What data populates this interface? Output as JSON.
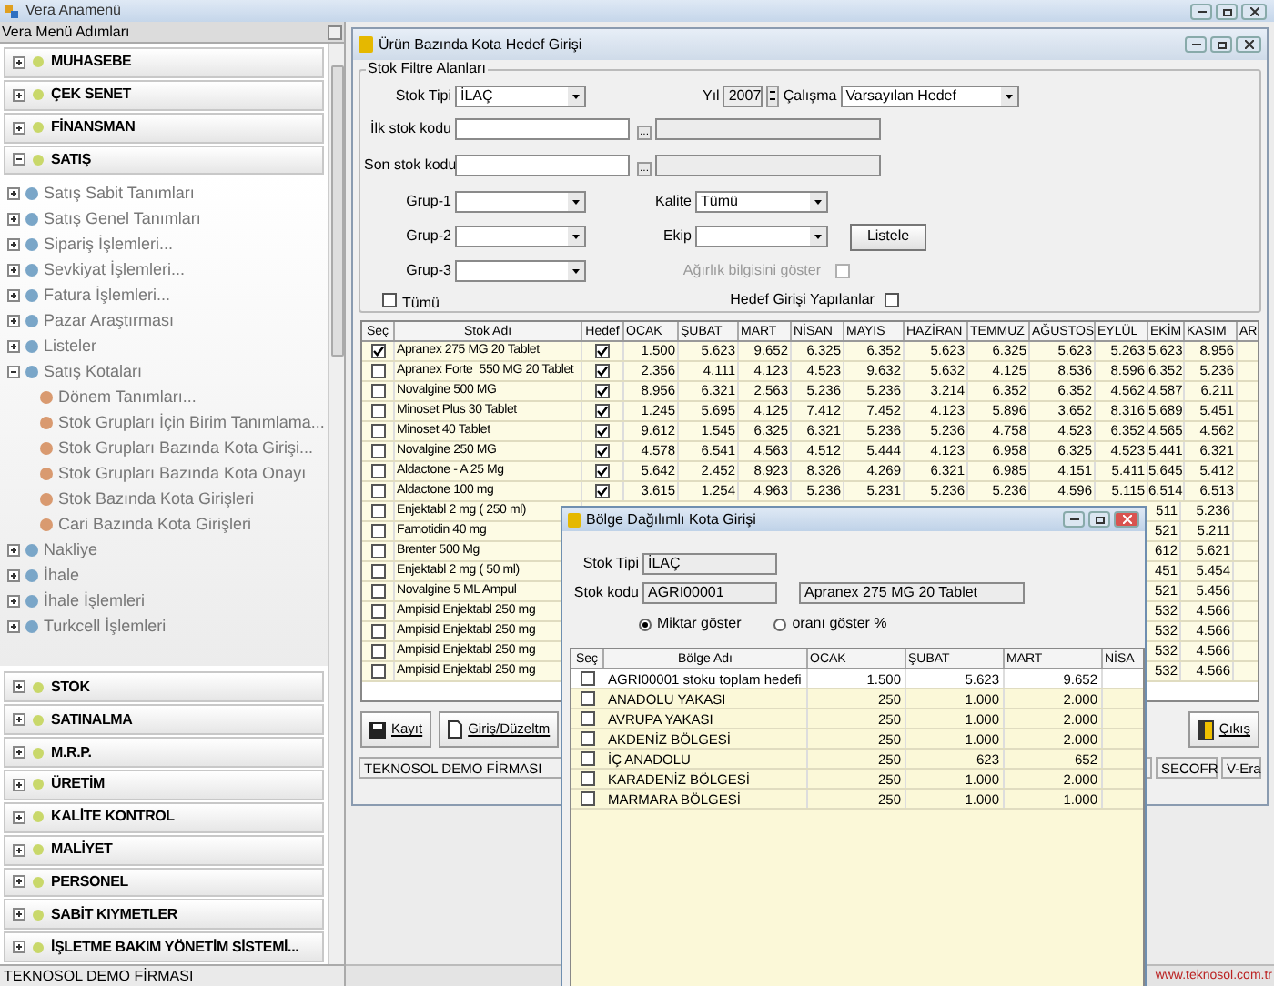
{
  "app_title": "Vera Anamenü",
  "menu": {
    "title": "Vera Menü Adımları",
    "sections_top": [
      {
        "label": "MUHASEBE",
        "expanded": false
      },
      {
        "label": "ÇEK SENET",
        "expanded": false
      },
      {
        "label": "FİNANSMAN",
        "expanded": false
      },
      {
        "label": "SATIŞ",
        "expanded": true
      }
    ],
    "tree": [
      {
        "label": "Satış Sabit Tanımları",
        "expanded": false
      },
      {
        "label": "Satış Genel Tanımları",
        "expanded": false
      },
      {
        "label": "Sipariş İşlemleri...",
        "expanded": false
      },
      {
        "label": "Sevkiyat İşlemleri...",
        "expanded": false
      },
      {
        "label": "Fatura İşlemleri...",
        "expanded": false
      },
      {
        "label": "Pazar Araştırması",
        "expanded": false
      },
      {
        "label": "Listeler",
        "expanded": false
      },
      {
        "label": "Satış Kotaları",
        "expanded": true,
        "children": [
          {
            "label": "Dönem Tanımları..."
          },
          {
            "label": "Stok Grupları İçin Birim Tanımlama..."
          },
          {
            "label": "Stok Grupları Bazında Kota Girişi..."
          },
          {
            "label": "Stok Grupları Bazında Kota Onayı"
          },
          {
            "label": "Stok Bazında Kota Girişleri"
          },
          {
            "label": "Cari Bazında Kota Girişleri"
          }
        ]
      },
      {
        "label": "Nakliye",
        "expanded": false
      },
      {
        "label": "İhale",
        "expanded": false
      },
      {
        "label": "İhale İşlemleri",
        "expanded": false
      },
      {
        "label": "Turkcell İşlemleri",
        "expanded": false
      }
    ],
    "sections_bottom": [
      {
        "label": "STOK",
        "expanded": false
      },
      {
        "label": "SATINALMA",
        "expanded": false
      },
      {
        "label": "M.R.P.",
        "expanded": false
      },
      {
        "label": "ÜRETİM",
        "expanded": false
      },
      {
        "label": "KALİTE KONTROL",
        "expanded": false
      },
      {
        "label": "MALİYET",
        "expanded": false
      },
      {
        "label": "PERSONEL",
        "expanded": false
      },
      {
        "label": "SABİT KIYMETLER",
        "expanded": false
      },
      {
        "label": "İŞLETME BAKIM YÖNETİM SİSTEMİ...",
        "expanded": false
      }
    ]
  },
  "status_left": "TEKNOSOL DEMO FİRMASI",
  "status_right": "www.teknosol.com.tr",
  "form": {
    "title": "Ürün Bazında Kota Hedef Girişi",
    "filter_title": "Stok Filtre Alanları",
    "stok_tipi": {
      "label": "Stok Tipi",
      "value": "İLAÇ"
    },
    "yil": {
      "label": "Yıl",
      "value": "2007"
    },
    "calisma": {
      "label": "Çalışma",
      "value": "Varsayılan Hedef"
    },
    "ilk_stok_kodu": {
      "label": "İlk stok kodu",
      "button": "..."
    },
    "son_stok_kodu": {
      "label": "Son stok kodu",
      "button": "..."
    },
    "grup_1": {
      "label": "Grup-1"
    },
    "grup_2": {
      "label": "Grup-2"
    },
    "grup_3": {
      "label": "Grup-3"
    },
    "kalite": {
      "label": "Kalite",
      "value": "Tümü"
    },
    "ekip": {
      "label": "Ekip"
    },
    "listele": "Listele",
    "agirlik": {
      "label": "Ağırlık bilgisini göster",
      "checked": false,
      "disabled": true
    },
    "hedef_girisi": {
      "label": "Hedef Girişi Yapılanlar",
      "checked": false,
      "disabled": false
    },
    "tumu": {
      "label": "Tümü",
      "checked": false
    },
    "columns": [
      "Seç",
      "Stok Adı",
      "Hedef",
      "OCAK",
      "ŞUBAT",
      "MART",
      "NİSAN",
      "MAYIS",
      "HAZİRAN",
      "TEMMUZ",
      "AĞUSTOS",
      "EYLÜL",
      "EKİM",
      "KASIM",
      "AR"
    ],
    "rows": [
      {
        "checked": true,
        "name": "Apranex 275 MG 20 Tablet",
        "hedef": true,
        "values": [
          "1.500",
          "5.623",
          "9.652",
          "6.325",
          "6.352",
          "5.623",
          "6.325",
          "5.623",
          "5.263",
          "5.623",
          "8.956"
        ]
      },
      {
        "checked": false,
        "name": "Apranex Forte  550 MG 20 Tablet",
        "hedef": true,
        "values": [
          "2.356",
          "4.111",
          "4.123",
          "4.523",
          "9.632",
          "5.632",
          "4.125",
          "8.536",
          "8.596",
          "6.352",
          "5.236"
        ]
      },
      {
        "checked": false,
        "name": "Novalgine 500 MG",
        "hedef": true,
        "values": [
          "8.956",
          "6.321",
          "2.563",
          "5.236",
          "5.236",
          "3.214",
          "6.352",
          "6.352",
          "4.562",
          "4.587",
          "6.211"
        ]
      },
      {
        "checked": false,
        "name": "Minoset Plus 30 Tablet",
        "hedef": true,
        "values": [
          "1.245",
          "5.695",
          "4.125",
          "7.412",
          "7.452",
          "4.123",
          "5.896",
          "3.652",
          "8.316",
          "5.689",
          "5.451"
        ]
      },
      {
        "checked": false,
        "name": "Minoset 40 Tablet",
        "hedef": true,
        "values": [
          "9.612",
          "1.545",
          "6.325",
          "6.321",
          "5.236",
          "5.236",
          "4.758",
          "4.523",
          "6.352",
          "4.565",
          "4.562"
        ]
      },
      {
        "checked": false,
        "name": "Novalgine 250 MG",
        "hedef": true,
        "values": [
          "4.578",
          "6.541",
          "4.563",
          "4.512",
          "5.444",
          "4.123",
          "6.958",
          "6.325",
          "4.523",
          "5.441",
          "6.321"
        ]
      },
      {
        "checked": false,
        "name": "Aldactone - A 25 Mg",
        "hedef": true,
        "values": [
          "5.642",
          "2.452",
          "8.923",
          "8.326",
          "4.269",
          "6.321",
          "6.985",
          "4.151",
          "5.411",
          "5.645",
          "5.412"
        ]
      },
      {
        "checked": false,
        "name": "Aldactone 100 mg",
        "hedef": true,
        "values": [
          "3.615",
          "1.254",
          "4.963",
          "5.236",
          "5.231",
          "5.236",
          "5.236",
          "4.596",
          "5.115",
          "6.514",
          "6.513"
        ]
      },
      {
        "checked": false,
        "name": "Enjektabl 2 mg ( 250 ml)",
        "ekim_part": "511",
        "kasim": "5.236"
      },
      {
        "checked": false,
        "name": "Famotidin 40 mg",
        "ekim_part": "521",
        "kasim": "5.211"
      },
      {
        "checked": false,
        "name": "Brenter 500 Mg",
        "ekim_part": "612",
        "kasim": "5.621"
      },
      {
        "checked": false,
        "name": "Enjektabl 2 mg ( 50 ml)",
        "ekim_part": "451",
        "kasim": "5.454"
      },
      {
        "checked": false,
        "name": "Novalgine 5 ML Ampul",
        "ekim_part": "521",
        "kasim": "5.456"
      },
      {
        "checked": false,
        "name": "Ampisid Enjektabl 250 mg",
        "ekim_part": "532",
        "kasim": "4.566"
      },
      {
        "checked": false,
        "name": "Ampisid Enjektabl 250 mg",
        "ekim_part": "532",
        "kasim": "4.566"
      },
      {
        "checked": false,
        "name": "Ampisid Enjektabl 250 mg",
        "ekim_part": "532",
        "kasim": "4.566"
      },
      {
        "checked": false,
        "name": "Ampisid Enjektabl 250 mg",
        "ekim_part": "532",
        "kasim": "4.566"
      }
    ],
    "buttons": [
      {
        "kind": "save",
        "label": "Kayıt"
      },
      {
        "kind": "edit",
        "label": "Giriş/Düzeltm"
      },
      {
        "kind": "exit",
        "label": "Çıkış"
      }
    ],
    "status": [
      "TEKNOSOL DEMO FİRMASI",
      "SECOFR",
      "V-Era"
    ]
  },
  "dialog": {
    "title": "Bölge Dağılımlı Kota Girişi",
    "stok_tipi": {
      "label": "Stok Tipi",
      "value": "İLAÇ"
    },
    "stok_kodu": {
      "label": "Stok kodu",
      "value": "AGRI00001",
      "name": "Apranex 275 MG 20 Tablet"
    },
    "options": [
      {
        "label": "Miktar göster",
        "selected": true
      },
      {
        "label": "oranı göster %",
        "selected": false
      }
    ],
    "columns": [
      "Seç",
      "Bölge Adı",
      "OCAK",
      "ŞUBAT",
      "MART",
      "NİSA"
    ],
    "rows": [
      {
        "checked": false,
        "total": true,
        "name": "AGRI00001 stoku toplam hedefi",
        "values": [
          "1.500",
          "5.623",
          "9.652"
        ]
      },
      {
        "checked": false,
        "total": false,
        "name": "ANADOLU YAKASI",
        "values": [
          "250",
          "1.000",
          "2.000"
        ]
      },
      {
        "checked": false,
        "total": false,
        "name": "AVRUPA YAKASI",
        "values": [
          "250",
          "1.000",
          "2.000"
        ]
      },
      {
        "checked": false,
        "total": false,
        "name": "AKDENİZ BÖLGESİ",
        "values": [
          "250",
          "1.000",
          "2.000"
        ]
      },
      {
        "checked": false,
        "total": false,
        "name": "İÇ ANADOLU",
        "values": [
          "250",
          "623",
          "652"
        ]
      },
      {
        "checked": false,
        "total": false,
        "name": "KARADENİZ BÖLGESİ",
        "values": [
          "250",
          "1.000",
          "2.000"
        ]
      },
      {
        "checked": false,
        "total": false,
        "name": "MARMARA BÖLGESİ",
        "values": [
          "250",
          "1.000",
          "1.000"
        ]
      }
    ]
  }
}
